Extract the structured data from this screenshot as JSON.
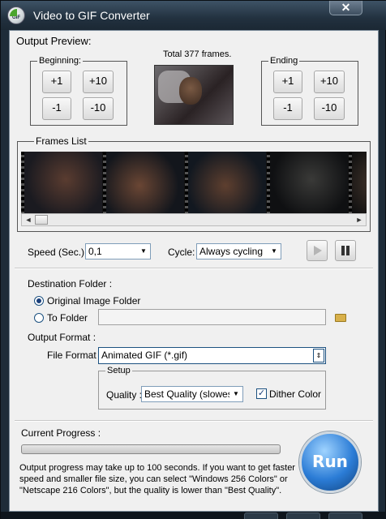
{
  "window": {
    "title": "Video to GIF Converter",
    "icon_text": "GIF",
    "close": "✕"
  },
  "preview": {
    "heading": "Output Preview:",
    "total_frames": "Total 377 frames.",
    "beginning": {
      "title": "Beginning:",
      "buttons": [
        "+1",
        "+10",
        "-1",
        "-10"
      ]
    },
    "ending": {
      "title": "Ending",
      "buttons": [
        "+1",
        "+10",
        "-1",
        "-10"
      ]
    }
  },
  "frames": {
    "title": "Frames List",
    "scroll_left": "◄",
    "scroll_right": "►"
  },
  "playback": {
    "speed_label": "Speed (Sec.):",
    "speed_value": "0,1",
    "cycle_label": "Cycle:",
    "cycle_value": "Always cycling",
    "play_icon": "play-icon",
    "pause_icon": "pause-icon"
  },
  "destination": {
    "heading": "Destination Folder :",
    "option_original": "Original Image Folder",
    "option_folder": "To Folder",
    "selected": "Original Image Folder",
    "folder_path": ""
  },
  "output_format": {
    "heading": "Output Format :",
    "file_format_label": "File Format",
    "file_format_value": "Animated GIF (*.gif)",
    "setup_title": "Setup",
    "quality_label": "Quality :",
    "quality_value": "Best Quality (slowest)",
    "dither_label": "Dither Color",
    "dither_checked": true
  },
  "progress": {
    "label": "Current Progress :",
    "value": 0.0,
    "note": "Output progress may take up to 100 seconds. If you want to get faster speed and smaller file size, you can select \"Windows 256 Colors\" or \"Netscape 216 Colors\", but the quality is lower than \"Best Quality\"."
  },
  "run_button": "Run",
  "colors": {
    "accent": "#2b7cd6",
    "titlebar": "#22313f",
    "background": "#f0f0f0"
  }
}
